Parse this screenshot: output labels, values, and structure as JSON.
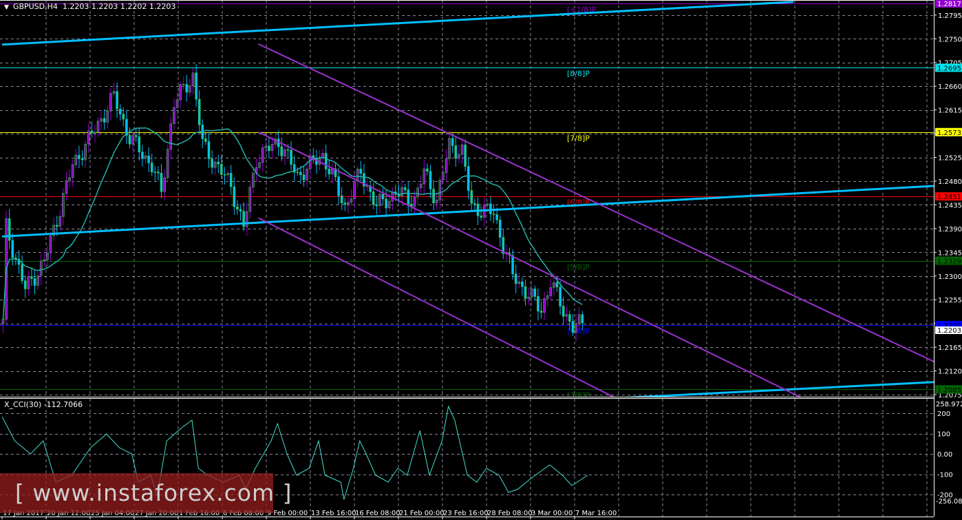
{
  "header": {
    "symbol": "GBPUSD,H4",
    "ohlc": "1.2203 1.2203 1.2202 1.2203"
  },
  "indicator": {
    "title": "X_CCI(30) -112.7066",
    "scale_top": "258.9723",
    "scale_bottom": "-256.087",
    "ticks": [
      "200",
      "100",
      "0.00",
      "-100",
      "-200"
    ]
  },
  "watermark": "[ www.instaforex.com ]",
  "price_axis": {
    "ticks": [
      "1.2795",
      "1.2750",
      "1.2705",
      "1.2660",
      "1.2615",
      "1.2570",
      "1.2525",
      "1.2480",
      "1.2435",
      "1.2390",
      "1.2345",
      "1.2300",
      "1.2255",
      "1.2210",
      "1.2165",
      "1.2120",
      "1.2075"
    ],
    "current_price": "1.2203"
  },
  "time_axis": [
    "17 Jan 2017",
    "20 Jan 12:00",
    "25 Jan 04:00",
    "27 Jan 20:00",
    "1 Feb 16:00",
    "6 Feb 08:00",
    "9 Feb 00:00",
    "13 Feb 16:00",
    "16 Feb 08:00",
    "21 Feb 00:00",
    "23 Feb 16:00",
    "28 Feb 08:00",
    "3 Mar 00:00",
    "7 Mar 16:00"
  ],
  "murrey_levels": [
    {
      "label": "[+1/8]P",
      "price": "1.2817",
      "color": "#9400d3",
      "text": "#fff"
    },
    {
      "label": "[8/8]P",
      "price": "1.2695",
      "color": "#00e5ee",
      "text": "#000"
    },
    {
      "label": "[7/8]P",
      "price": "1.2573",
      "color": "#ffff00",
      "text": "#000"
    },
    {
      "label": "[6/8]P",
      "price": "1.2451",
      "color": "#ff0000",
      "text": "#000"
    },
    {
      "label": "[5/8]P",
      "price": "1.2329",
      "color": "#006400",
      "text": "#000"
    },
    {
      "label": "[4/8]P",
      "price": "1.2207",
      "color": "#0000ff",
      "text": "#000"
    },
    {
      "label": "[3/8]P",
      "price": "1.2085",
      "color": "#006400",
      "text": "#000"
    }
  ],
  "chart_data": {
    "type": "candlestick",
    "price_range": [
      1.206,
      1.2824
    ],
    "price_path": [
      [
        1,
        1.2392
      ],
      [
        7,
        1.2275
      ],
      [
        13,
        1.2327
      ],
      [
        22,
        1.251
      ],
      [
        30,
        1.2588
      ],
      [
        35,
        1.264
      ],
      [
        40,
        1.2562
      ],
      [
        47,
        1.251
      ],
      [
        50,
        1.2458
      ],
      [
        54,
        1.2628
      ],
      [
        60,
        1.268
      ],
      [
        63,
        1.2549
      ],
      [
        72,
        1.2471
      ],
      [
        76,
        1.2392
      ],
      [
        80,
        1.2523
      ],
      [
        87,
        1.2556
      ],
      [
        93,
        1.249
      ],
      [
        101,
        1.253
      ],
      [
        108,
        1.2432
      ],
      [
        113,
        1.2497
      ],
      [
        118,
        1.2432
      ],
      [
        124,
        1.2458
      ],
      [
        130,
        1.2445
      ],
      [
        133,
        1.2497
      ],
      [
        137,
        1.2445
      ],
      [
        141,
        1.2549
      ],
      [
        145,
        1.2536
      ],
      [
        148,
        1.2432
      ],
      [
        155,
        1.2419
      ],
      [
        161,
        1.2301
      ],
      [
        170,
        1.2236
      ],
      [
        173,
        1.2288
      ],
      [
        177,
        1.2236
      ],
      [
        180,
        1.2203
      ],
      [
        183,
        1.221
      ]
    ],
    "ma_period": 20,
    "trend_lines": [
      {
        "color": "#00bfff",
        "from": [
          0,
          1.2739
        ],
        "to": [
          250,
          1.282
        ]
      },
      {
        "color": "#00bfff",
        "from": [
          0,
          1.2375
        ],
        "to": [
          295,
          1.2471
        ]
      },
      {
        "color": "#00bfff",
        "from": [
          180,
          1.2064
        ],
        "to": [
          295,
          1.2099
        ]
      },
      {
        "color": "#9932cc",
        "from": [
          81,
          1.274
        ],
        "to": [
          295,
          1.2136
        ]
      },
      {
        "color": "#9932cc",
        "from": [
          81,
          1.2573
        ],
        "to": [
          254,
          1.2065
        ]
      },
      {
        "color": "#9932cc",
        "from": [
          81,
          1.241
        ],
        "to": [
          196,
          1.2062
        ]
      }
    ],
    "cci": [
      [
        0,
        183
      ],
      [
        4,
        64
      ],
      [
        9,
        0
      ],
      [
        13,
        64
      ],
      [
        17,
        -139
      ],
      [
        22,
        -105
      ],
      [
        28,
        31
      ],
      [
        33,
        98
      ],
      [
        37,
        31
      ],
      [
        41,
        0
      ],
      [
        43,
        -139
      ],
      [
        47,
        -105
      ],
      [
        49,
        -207
      ],
      [
        52,
        64
      ],
      [
        57,
        132
      ],
      [
        60,
        166
      ],
      [
        62,
        -71
      ],
      [
        65,
        -105
      ],
      [
        70,
        -139
      ],
      [
        75,
        -105
      ],
      [
        77,
        -173
      ],
      [
        80,
        -71
      ],
      [
        85,
        64
      ],
      [
        87,
        149
      ],
      [
        90,
        0
      ],
      [
        93,
        -105
      ],
      [
        97,
        -71
      ],
      [
        100,
        64
      ],
      [
        102,
        -105
      ],
      [
        107,
        -139
      ],
      [
        108,
        -224
      ],
      [
        111,
        -71
      ],
      [
        113,
        64
      ],
      [
        115,
        0
      ],
      [
        118,
        -105
      ],
      [
        122,
        -139
      ],
      [
        125,
        -71
      ],
      [
        128,
        -105
      ],
      [
        132,
        115
      ],
      [
        135,
        -105
      ],
      [
        139,
        64
      ],
      [
        141,
        234
      ],
      [
        143,
        166
      ],
      [
        147,
        -105
      ],
      [
        150,
        -139
      ],
      [
        153,
        -71
      ],
      [
        157,
        -105
      ],
      [
        160,
        -190
      ],
      [
        163,
        -173
      ],
      [
        167,
        -122
      ],
      [
        173,
        -54
      ],
      [
        177,
        -105
      ],
      [
        180,
        -156
      ],
      [
        185,
        -105
      ]
    ]
  }
}
